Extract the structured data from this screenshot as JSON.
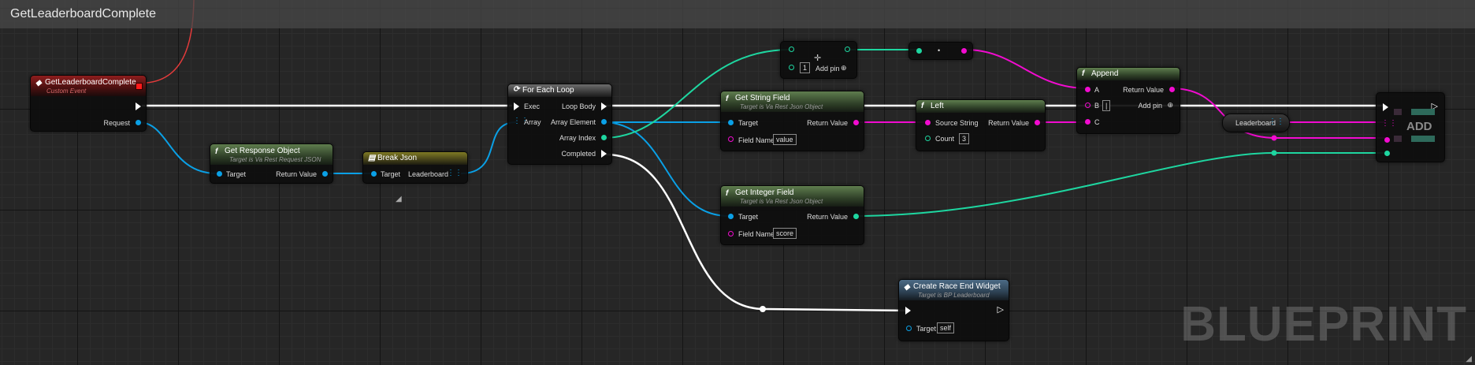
{
  "graph": {
    "title": "GetLeaderboardComplete",
    "watermark": "BLUEPRINT"
  },
  "colors": {
    "exec": "#ffffff",
    "object": "#0aa0e6",
    "string": "#f20bd0",
    "integer": "#1ed6a0",
    "event_header": "#8e1d1d",
    "function_header": "#5f7d4e"
  },
  "nodes": {
    "event": {
      "title": "GetLeaderboardComplete",
      "subtitle": "Custom Event",
      "request": "Request"
    },
    "get_response": {
      "title": "Get Response Object",
      "subtitle": "Target is Va Rest Request JSON",
      "target": "Target",
      "return": "Return Value"
    },
    "break_json": {
      "title": "Break Json",
      "target": "Target",
      "leaderboard": "Leaderboard"
    },
    "foreach": {
      "title": "For Each Loop",
      "exec": "Exec",
      "array": "Array",
      "loop_body": "Loop Body",
      "array_element": "Array Element",
      "array_index": "Array Index",
      "completed": "Completed"
    },
    "get_string": {
      "title": "Get String Field",
      "subtitle": "Target is Va Rest Json Object",
      "target": "Target",
      "field_name": "Field Name",
      "field_value": "value",
      "return": "Return Value"
    },
    "get_integer": {
      "title": "Get Integer Field",
      "subtitle": "Target is Va Rest Json Object",
      "target": "Target",
      "field_name": "Field Name",
      "field_value": "score",
      "return": "Return Value"
    },
    "add": {
      "value": "1",
      "add_pin": "Add pin"
    },
    "left": {
      "title": "Left",
      "source": "Source String",
      "count": "Count",
      "count_value": "3",
      "return": "Return Value"
    },
    "append": {
      "title": "Append",
      "a": "A",
      "b": "B",
      "b_value": "|",
      "c": "C",
      "return": "Return Value",
      "add_pin": "Add pin"
    },
    "create_widget": {
      "title": "Create Race End Widget",
      "subtitle": "Target is BP Leaderboard",
      "target": "Target",
      "target_value": "self"
    },
    "leaderboard_var": {
      "label": "Leaderboard"
    },
    "add_array": {
      "label": "ADD"
    }
  }
}
